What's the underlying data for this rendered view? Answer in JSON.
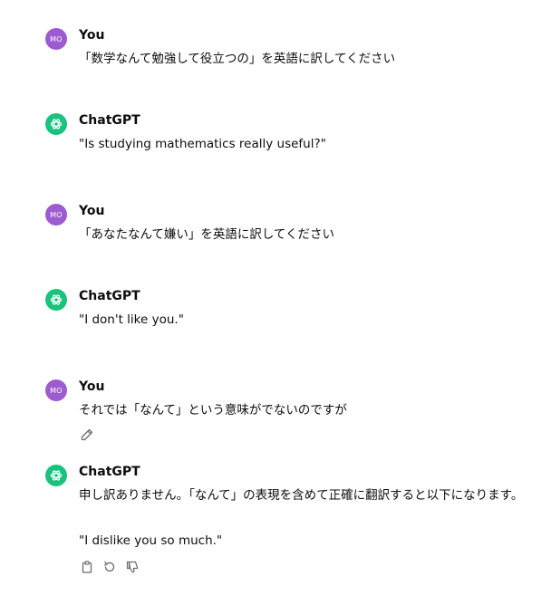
{
  "conversation": {
    "messages": [
      {
        "role": "user",
        "avatar_text": "MO",
        "author": "You",
        "lines": [
          "「数学なんて勉強して役立つの」を英語に訳してください"
        ]
      },
      {
        "role": "assistant",
        "author": "ChatGPT",
        "lines": [
          "\"Is studying mathematics really useful?\""
        ]
      },
      {
        "role": "user",
        "avatar_text": "MO",
        "author": "You",
        "lines": [
          "「あなたなんて嫌い」を英語に訳してください"
        ]
      },
      {
        "role": "assistant",
        "author": "ChatGPT",
        "lines": [
          "\"I don't like you.\""
        ]
      },
      {
        "role": "user",
        "avatar_text": "MO",
        "author": "You",
        "lines": [
          "それでは「なんて」という意味がでないのですが"
        ],
        "actions": [
          "edit-icon"
        ]
      },
      {
        "role": "assistant",
        "author": "ChatGPT",
        "lines": [
          "申し訳ありません。「なんて」の表現を含めて正確に翻訳すると以下になります。",
          "\"I dislike you so much.\""
        ],
        "actions": [
          "copy-icon",
          "regenerate-icon",
          "thumbs-down-icon"
        ]
      }
    ]
  },
  "colors": {
    "user_avatar": "#9c5bcf",
    "assistant_avatar": "#19c37d",
    "text": "#0d0d0d",
    "icon": "#6b6b6b"
  }
}
